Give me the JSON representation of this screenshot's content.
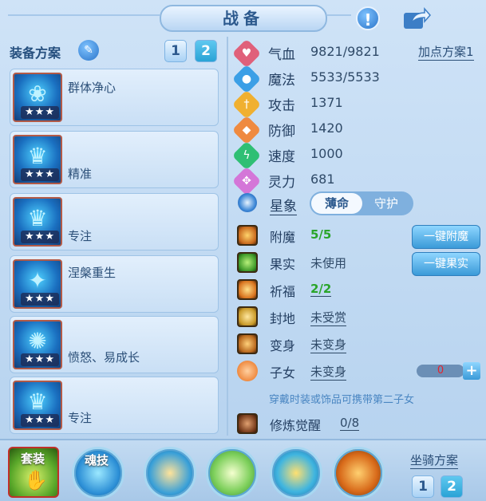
{
  "header": {
    "title": "战备"
  },
  "left_panel": {
    "scheme_label": "装备方案",
    "scheme_buttons": [
      "1",
      "2"
    ],
    "skills": [
      {
        "name": "群体净心",
        "stars": "★★★"
      },
      {
        "name": "精准",
        "stars": "★★★"
      },
      {
        "name": "专注",
        "stars": "★★★"
      },
      {
        "name": "涅槃重生",
        "stars": "★★★"
      },
      {
        "name": "愤怒、易成长",
        "stars": "★★★"
      },
      {
        "name": "专注",
        "stars": "★★★"
      }
    ]
  },
  "stats": {
    "add_point_link": "加点方案1",
    "rows": [
      {
        "label": "气血",
        "value": "9821/9821",
        "icon": "heart-icon",
        "color": "#e0607a"
      },
      {
        "label": "魔法",
        "value": "5533/5533",
        "icon": "mana-icon",
        "color": "#3b9fe6"
      },
      {
        "label": "攻击",
        "value": "1371",
        "icon": "attack-icon",
        "color": "#f0b030"
      },
      {
        "label": "防御",
        "value": "1420",
        "icon": "defense-icon",
        "color": "#ef8a40"
      },
      {
        "label": "速度",
        "value": "1000",
        "icon": "speed-icon",
        "color": "#2fbf74"
      },
      {
        "label": "灵力",
        "value": "681",
        "icon": "spirit-icon",
        "color": "#d476d8"
      }
    ],
    "star_label": "星象",
    "star_options": [
      "薄命",
      "守护"
    ],
    "star_selected": "薄命"
  },
  "misc": {
    "rows": [
      {
        "label": "附魔",
        "value": "5/5",
        "icon": "enchant-icon"
      },
      {
        "label": "果实",
        "value": "未使用",
        "icon": "fruit-icon"
      },
      {
        "label": "祈福",
        "value": "2/2",
        "icon": "blessing-icon"
      },
      {
        "label": "封地",
        "value": "未受赏",
        "icon": "fief-icon"
      },
      {
        "label": "变身",
        "value": "未变身",
        "icon": "transform-icon"
      },
      {
        "label": "子女",
        "value": "未变身",
        "icon": "child-icon"
      }
    ],
    "one_click_enchant": "一键附魔",
    "one_click_fruit": "一键果实",
    "child_count": "0",
    "hint": "穿戴时装或饰品可携带第二子女",
    "cultivation_label": "修炼觉醒",
    "cultivation_value": "0/8"
  },
  "bottom": {
    "tab_set": "套装",
    "tab_soul": "魂技",
    "mount_label": "坐骑方案",
    "mount_buttons": [
      "1",
      "2"
    ]
  }
}
